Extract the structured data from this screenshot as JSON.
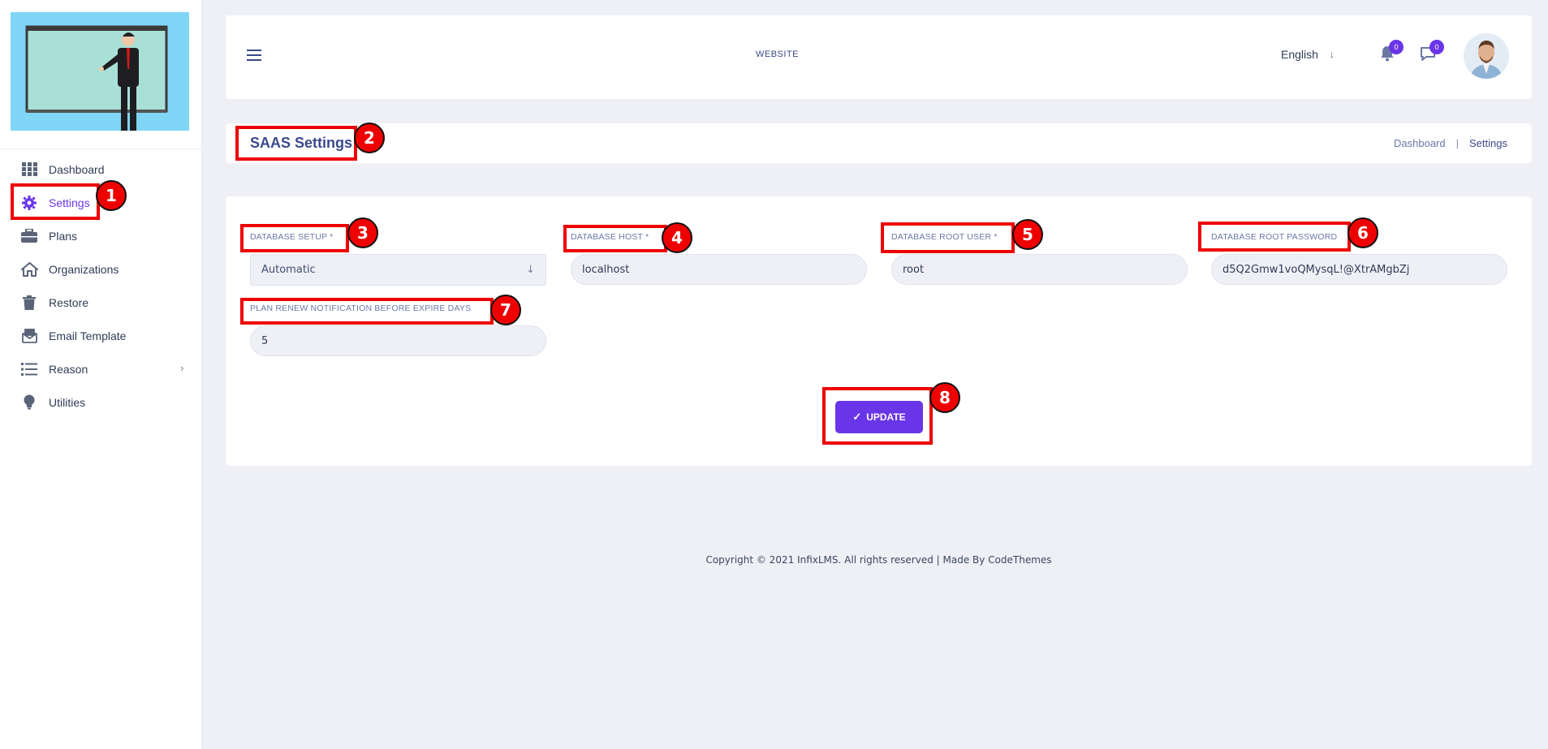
{
  "sidebar": {
    "items": [
      {
        "label": "Dashboard",
        "icon": "grid-icon"
      },
      {
        "label": "Settings",
        "icon": "gear-icon"
      },
      {
        "label": "Plans",
        "icon": "briefcase-icon"
      },
      {
        "label": "Organizations",
        "icon": "home-icon"
      },
      {
        "label": "Restore",
        "icon": "trash-icon"
      },
      {
        "label": "Email Template",
        "icon": "envelope-icon"
      },
      {
        "label": "Reason",
        "icon": "list-icon"
      },
      {
        "label": "Utilities",
        "icon": "lightbulb-icon"
      }
    ]
  },
  "header": {
    "website_label": "WEBSITE",
    "language": "English",
    "notifications_count": "0",
    "messages_count": "0"
  },
  "page": {
    "title": "SAAS Settings",
    "breadcrumb": [
      "Dashboard",
      "Settings"
    ]
  },
  "form": {
    "database_setup": {
      "label": "DATABASE SETUP *",
      "value": "Automatic"
    },
    "database_host": {
      "label": "DATABASE HOST *",
      "value": "localhost"
    },
    "database_root_user": {
      "label": "DATABASE ROOT USER *",
      "value": "root"
    },
    "database_root_password": {
      "label": "DATABASE ROOT PASSWORD",
      "value": "d5Q2Gmw1voQMysqL!@XtrAMgbZj"
    },
    "plan_renew_days": {
      "label": "PLAN RENEW NOTIFICATION BEFORE EXPIRE DAYS",
      "value": "5"
    },
    "update_label": "UPDATE"
  },
  "annotations": [
    "1",
    "2",
    "3",
    "4",
    "5",
    "6",
    "7",
    "8"
  ],
  "footer": {
    "copyright": "Copyright © 2021 InfixLMS. All rights reserved | Made By CodeThemes"
  },
  "colors": {
    "accent": "#6a35e8",
    "annotation_red": "#ee0000",
    "background": "#eff0f6"
  }
}
